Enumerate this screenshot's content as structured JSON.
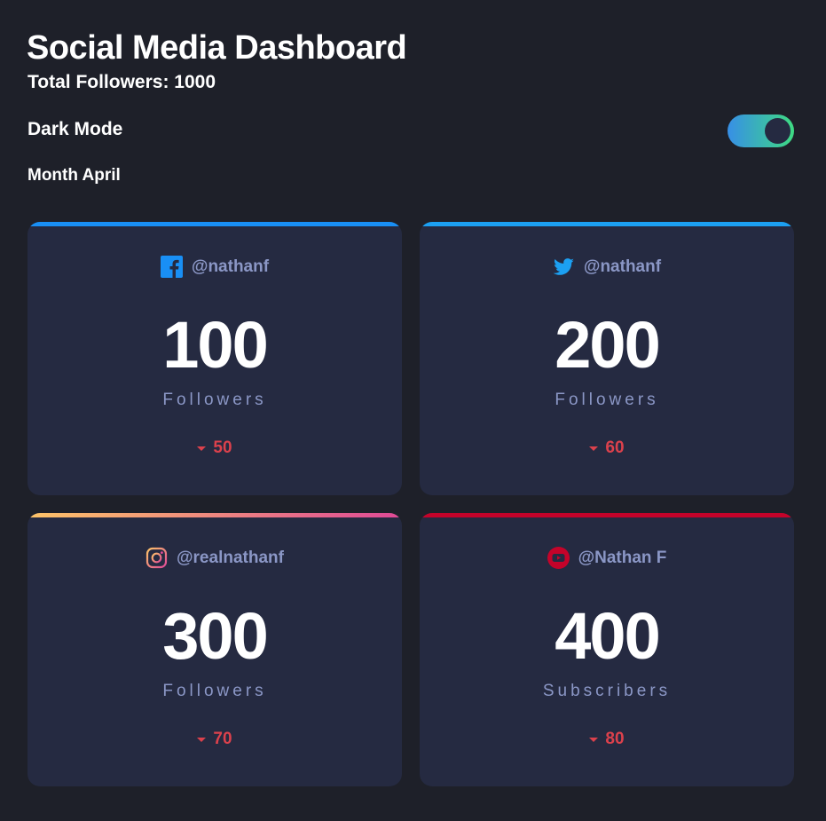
{
  "header": {
    "title": "Social Media Dashboard",
    "total_followers": "Total Followers: 1000",
    "mode_label": "Dark Mode",
    "month": "Month April",
    "dark_mode_on": true
  },
  "cards": [
    {
      "platform": "facebook",
      "icon": "facebook-icon",
      "accent": "#198ff5",
      "handle": "@nathanf",
      "count": "100",
      "unit": "Followers",
      "change": "50",
      "trend": "down"
    },
    {
      "platform": "twitter",
      "icon": "twitter-icon",
      "accent": "#1ca0f2",
      "handle": "@nathanf",
      "count": "200",
      "unit": "Followers",
      "change": "60",
      "trend": "down"
    },
    {
      "platform": "instagram",
      "icon": "instagram-icon",
      "accent": "#fdc468",
      "handle": "@realnathanf",
      "count": "300",
      "unit": "Followers",
      "change": "70",
      "trend": "down"
    },
    {
      "platform": "youtube",
      "icon": "youtube-icon",
      "accent": "#c4032a",
      "handle": "@Nathan F",
      "count": "400",
      "unit": "Subscribers",
      "change": "80",
      "trend": "down"
    }
  ],
  "colors": {
    "background": "#1e2029",
    "card": "#252a41",
    "muted_text": "#8b97c6",
    "down": "#dc414c",
    "toggle_gradient": [
      "#378fe6",
      "#3eda82"
    ],
    "instagram_gradient": [
      "#fdc468",
      "#df4996"
    ]
  }
}
